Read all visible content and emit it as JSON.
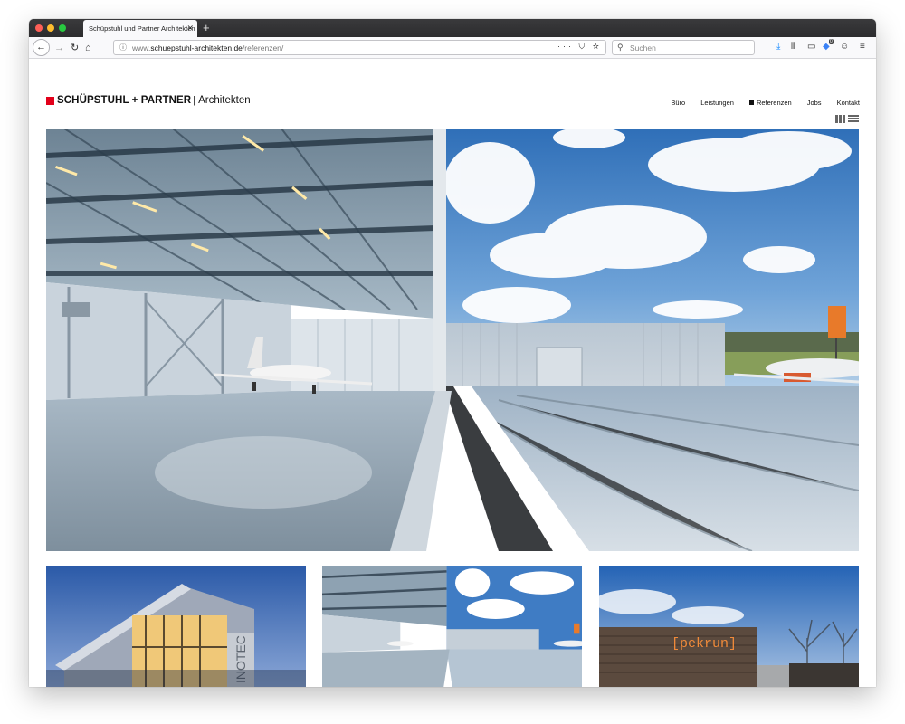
{
  "browser": {
    "tab_title": "Schüpstuhl und Partner Architekten",
    "url_prefix": "www.",
    "url_domain": "schuepstuhl-architekten.de",
    "url_path": "/referenzen/",
    "search_placeholder": "Suchen",
    "badge_count": "0"
  },
  "site": {
    "logo_main": "SCHÜPSTUHL + PARTNER",
    "logo_sub": "Architekten",
    "nav": [
      {
        "label": "Büro"
      },
      {
        "label": "Leistungen"
      },
      {
        "label": "Referenzen",
        "active": true
      },
      {
        "label": "Jobs"
      },
      {
        "label": "Kontakt"
      }
    ],
    "brand_color": "#e2001a"
  },
  "gallery": {
    "hero_alt": "hangar-photo",
    "thumb3_sign": "[pekrun]",
    "thumb1_sign": "INOTEC"
  }
}
